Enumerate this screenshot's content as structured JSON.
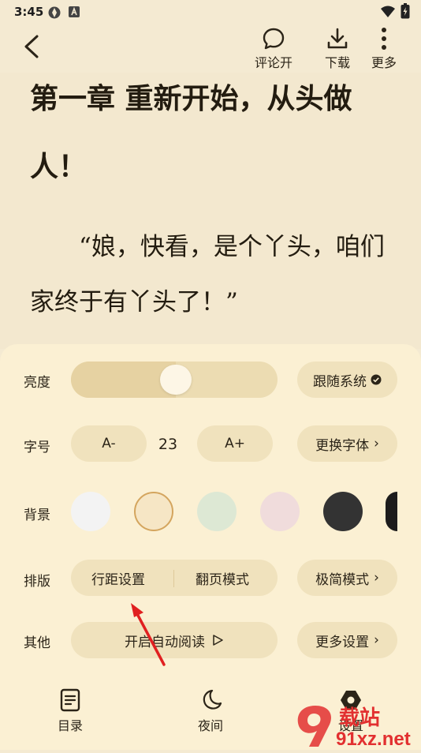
{
  "status_bar": {
    "time": "3:45"
  },
  "topbar": {
    "comments_label": "评论开",
    "download_label": "下载",
    "more_label": "更多"
  },
  "reader": {
    "chapter_title": "第一章 重新开始，从头做人！",
    "paragraph": "“娘，快看，是个丫头，咱们家终于有丫头了！”"
  },
  "settings": {
    "brightness": {
      "label": "亮度",
      "level": 0.51,
      "follow_system_label": "跟随系统",
      "follow_system_checked": true
    },
    "font_size": {
      "label": "字号",
      "decrease_label": "A-",
      "value": "23",
      "increase_label": "A+",
      "change_font_label": "更换字体"
    },
    "background": {
      "label": "背景",
      "swatches": [
        "#f3f3f3",
        "#f6e6c5",
        "#dde8d4",
        "#f0dcdc",
        "#333333",
        "#1c1c1c"
      ],
      "selected_index": 1
    },
    "layout": {
      "label": "排版",
      "line_spacing_label": "行距设置",
      "page_mode_label": "翻页模式",
      "minimal_mode_label": "极简模式"
    },
    "other": {
      "label": "其他",
      "auto_read_label": "开启自动阅读",
      "more_settings_label": "更多设置"
    }
  },
  "bottom_nav": {
    "toc_label": "目录",
    "night_label": "夜间",
    "settings_label": "设置"
  },
  "watermark": {
    "text_top": "载站",
    "text_bottom": "91xz.net"
  },
  "colors": {
    "panel_bg": "#fbf0d3",
    "pill_bg": "#f0e2bd",
    "accent": "#d4a55e",
    "arrow": "#e02020"
  }
}
